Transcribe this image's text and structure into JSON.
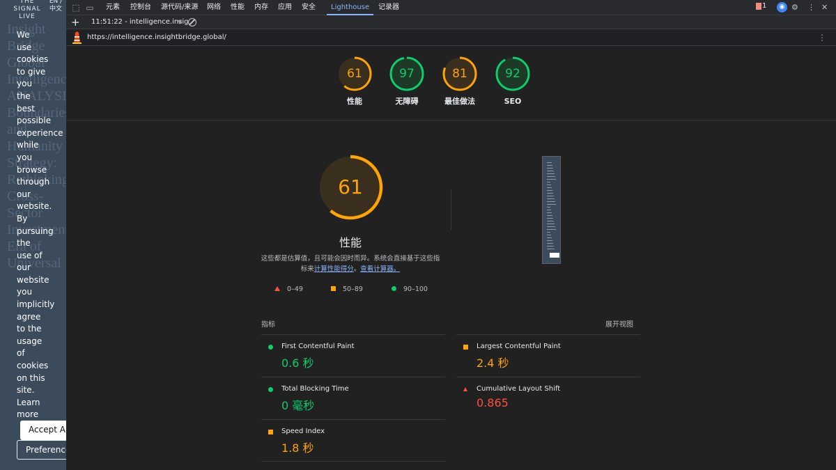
{
  "site": {
    "brand": "THE SIGNAL LIVE",
    "lang": "EN / 中文",
    "bg_text": "Insight Bridge Global Intelligence ANALYSIS Boundaries and Humanity Strategy: Rethinking Cross-Sector Investment Era of Universal",
    "cookie_words": [
      "We",
      "use",
      "cookies",
      "to give",
      "you",
      "the",
      "best",
      "possible",
      "experience",
      "while",
      "you",
      "browse",
      "through",
      "our",
      "website.",
      "By",
      "pursuing",
      "the",
      "use of",
      "our",
      "website",
      "you",
      "implicitly",
      "agree",
      "to the",
      "usage",
      "of",
      "cookies",
      "on this",
      "site.",
      "Learn",
      "more"
    ],
    "accept_label": "Accept All",
    "preferences_label": "Preferences"
  },
  "devtools": {
    "tabs": [
      "元素",
      "控制台",
      "源代码/来源",
      "网络",
      "性能",
      "内存",
      "应用",
      "安全",
      "Lighthouse",
      "记录器"
    ],
    "active_tab": "Lighthouse",
    "issues_count": "1",
    "report_selector": "11:51:22 - intelligence.insig",
    "url": "https://intelligence.insightbridge.global/"
  },
  "scores": [
    {
      "label": "性能",
      "score": 61,
      "color": "#ffa400"
    },
    {
      "label": "无障碍",
      "score": 97,
      "color": "#0cce6b"
    },
    {
      "label": "最佳做法",
      "score": 81,
      "color": "#ffa400"
    },
    {
      "label": "SEO",
      "score": 92,
      "color": "#0cce6b"
    }
  ],
  "performance": {
    "title": "性能",
    "score": 61,
    "desc_prefix": "这些都是估算值，且可能会因时而异。系统会直接基于这些指标来",
    "desc_link1": "计算性能得分",
    "desc_mid": "。",
    "desc_link2": "查看计算器。",
    "legend": {
      "fail": "0–49",
      "average": "50–89",
      "pass": "90–100"
    }
  },
  "metrics": {
    "header": "指标",
    "expand": "展开视图",
    "items": [
      {
        "name": "First Contentful Paint",
        "value": "0.6 秒",
        "rating": "pass"
      },
      {
        "name": "Largest Contentful Paint",
        "value": "2.4 秒",
        "rating": "average"
      },
      {
        "name": "Total Blocking Time",
        "value": "0 毫秒",
        "rating": "pass"
      },
      {
        "name": "Cumulative Layout Shift",
        "value": "0.865",
        "rating": "fail"
      },
      {
        "name": "Speed Index",
        "value": "1.8 秒",
        "rating": "average"
      }
    ]
  }
}
